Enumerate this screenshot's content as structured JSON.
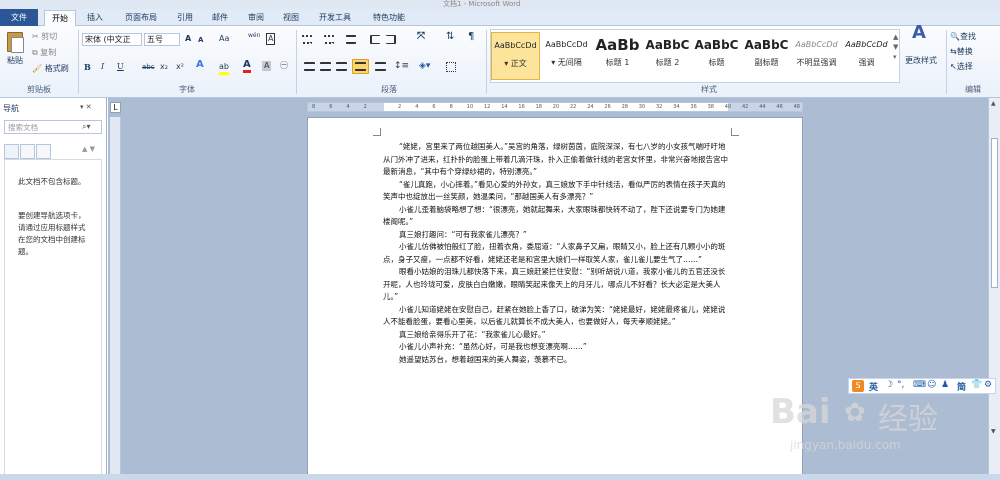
{
  "window": {
    "title": "文档1 - Microsoft Word"
  },
  "tabs": [
    "文件",
    "开始",
    "插入",
    "页面布局",
    "引用",
    "邮件",
    "审阅",
    "视图",
    "开发工具",
    "特色功能"
  ],
  "clipboard": {
    "paste": "粘贴",
    "cut": "剪切",
    "copy": "复制",
    "painter": "格式刷",
    "label": "剪贴板"
  },
  "font": {
    "name": "宋体 (中文正",
    "size": "五号",
    "label": "字体",
    "grow": "A",
    "shrink": "A",
    "clear": "Aa",
    "phon": "wén",
    "border": "A",
    "bold": "B",
    "italic": "I",
    "underline": "U",
    "strike": "abc",
    "sub": "x₂",
    "sup": "x²",
    "effects": "A",
    "highlight": "ab",
    "color": "A",
    "shade": "A",
    "circle": "㊀"
  },
  "paragraph": {
    "label": "段落"
  },
  "styles": {
    "label": "样式",
    "items": [
      {
        "preview": "AaBbCcDd",
        "name": "正文"
      },
      {
        "preview": "AaBbCcDd",
        "name": "无间隔"
      },
      {
        "preview": "AaBb",
        "name": "标题 1"
      },
      {
        "preview": "AaBbC",
        "name": "标题 2"
      },
      {
        "preview": "AaBbC",
        "name": "标题"
      },
      {
        "preview": "AaBbC",
        "name": "副标题"
      },
      {
        "preview": "AaBbCcDd",
        "name": "不明显强调"
      },
      {
        "preview": "AaBbCcDd",
        "name": "强调"
      }
    ],
    "change": "更改样式"
  },
  "editing": {
    "find": "查找",
    "replace": "替换",
    "select": "选择",
    "label": "编辑"
  },
  "nav": {
    "title": "导航",
    "search_placeholder": "搜索文档",
    "msg1": "此文档不包含标题。",
    "msg2": "要创建导航选项卡，请通过应用标题样式在您的文档中创建标题。"
  },
  "ruler": {
    "ticks": [
      "8",
      "6",
      "4",
      "2",
      "",
      "2",
      "4",
      "6",
      "8",
      "10",
      "12",
      "14",
      "16",
      "18",
      "20",
      "22",
      "24",
      "26",
      "28",
      "30",
      "32",
      "34",
      "36",
      "38",
      "40",
      "42",
      "44",
      "46",
      "48"
    ]
  },
  "document": {
    "paragraphs": [
      "“姥姥，宫里来了两位越国美人。”吴宫的角落，绿树茵茵，庭院深深，有七八岁的小女孩气喘吁吁地从门外冲了进来，红扑扑的脸蛋上带着几滴汗珠，扑入正偷着做针线的老宫女怀里，非常兴奋地报告宫中最新消息，“其中有个穿绿纱裙的，特别漂亮。”",
      "“雀儿真跑，小心摔着。”看见心爱的外孙女，真三娘放下手中针线活，看似严厉的表情在孩子天真的笑声中也绽放出一丝笑颜，她温柔问，“那越国美人有多漂亮？”",
      "小雀儿歪着脑袋略想了想：“很漂亮，她就起舞来，大家眼珠都快转不动了，陛下还说要专门为她建楼阁呢。”",
      "真三娘打趣问：“可有我家雀儿漂亮？”",
      "小雀儿仿佛被怕般红了脸，扭着衣角，委屈道：“人家鼻子又扁，眼睛又小，脸上还有几颗小小的斑点，身子又瘦，一点都不好看，姥姥还老是和宫里大娘们一样取笑人家，雀儿雀儿要生气了……”",
      "眼看小姑娘的泪珠儿都快落下来，真三娘赶紧拦住安慰：“别听胡说八道，我家小雀儿的五官还没长开呢，人也玲珑可爱，皮肤白白嫩嫩，眼睛笑起来像天上的月牙儿，哪点儿不好看？长大必定是大美人儿。”",
      "小雀儿知道姥姥在安慰自己，赶紧在她脸上香了口，破涕为笑：“姥姥最好，姥姥最疼雀儿，姥姥说人不能看脸蛋，要看心里美，以后雀儿就算长不成大美人，也要做好人，每天孝顺姥姥。”",
      "真三娘给亲得乐开了花：“我家雀儿心最好。”",
      "小雀儿小声补充：“虽然心好，可是我也想变漂亮啊……”",
      "她遥望姑苏台，想着越国来的美人舞姿，羡慕不已。"
    ]
  },
  "ime": {
    "lang": "英",
    "simp": "简"
  },
  "watermark": {
    "brand": "Bai",
    "brand2": "经验",
    "url": "jingyan.baidu.com"
  }
}
